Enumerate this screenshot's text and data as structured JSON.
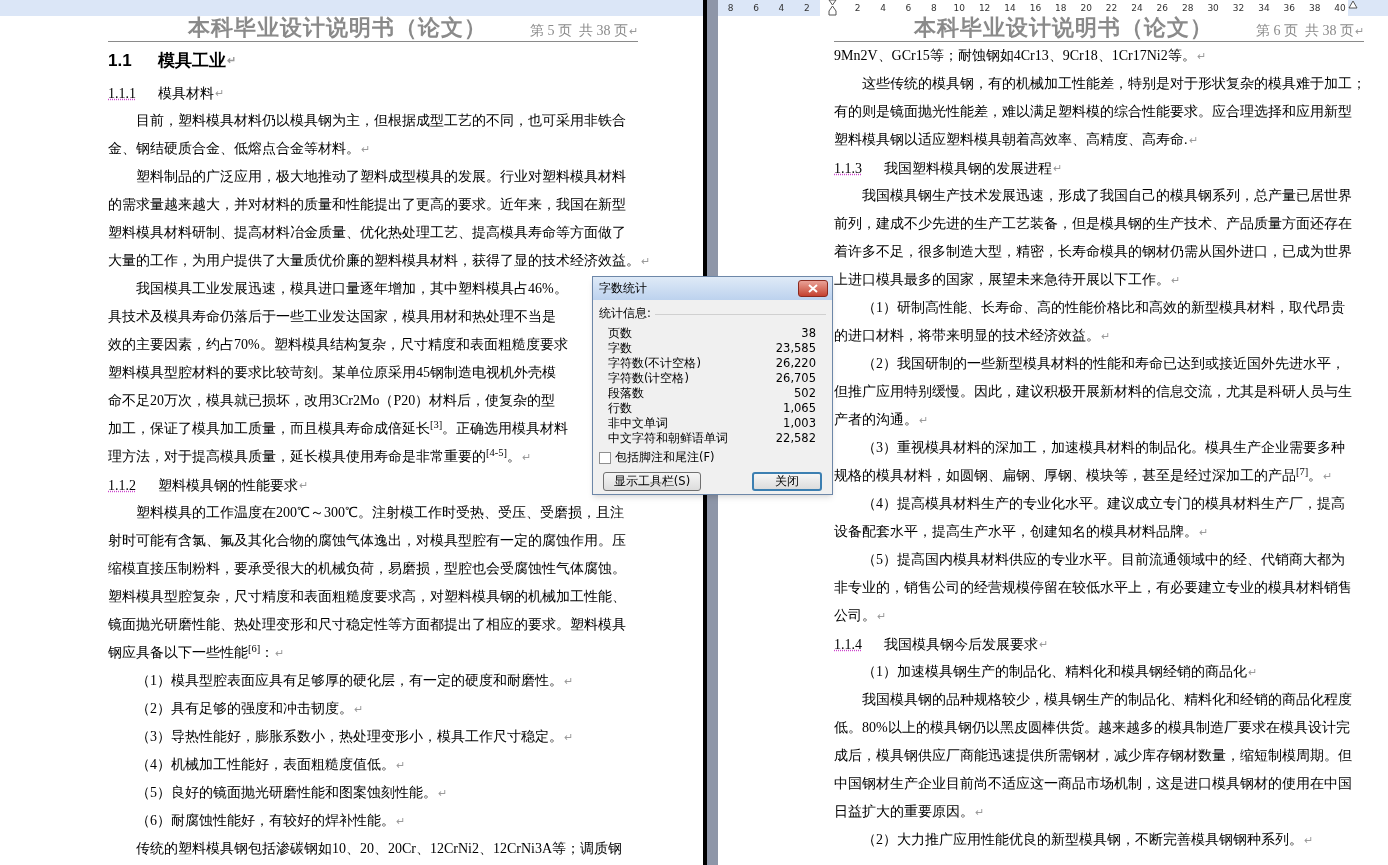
{
  "ruler": {
    "left_labels": [
      "8",
      "6",
      "4",
      "2"
    ],
    "right_labels": [
      "2",
      "4",
      "6",
      "8",
      "10",
      "12",
      "14",
      "16",
      "18",
      "20",
      "22",
      "24",
      "26",
      "28",
      "30",
      "32",
      "34",
      "36",
      "38",
      "40"
    ]
  },
  "pages": [
    {
      "header": {
        "title": "本科毕业设计说明书（论文）",
        "page_info": "第 5 页  共 38 页",
        "mark": "↵"
      },
      "blocks": [
        {
          "kind": "h2",
          "number": "1.1",
          "title": "模具工业",
          "mark": "↵"
        },
        {
          "kind": "h3",
          "number": "1.1.1",
          "title": "模具材料",
          "mark": "↵"
        },
        {
          "kind": "body",
          "lines": [
            "目前，塑料模具材料仍以模具钢为主，但根据成型工艺的不同，也可采用非铁合",
            "金、钢结硬质合金、低熔点合金等材料。"
          ],
          "mark": "↵"
        },
        {
          "kind": "body",
          "lines": [
            "塑料制品的广泛应用，极大地推动了塑料成型模具的发展。行业对塑料模具材料",
            "的需求量越来越大，并对材料的质量和性能提出了更高的要求。近年来，我国在新型",
            "塑料模具材料研制、提高材料冶金质量、优化热处理工艺、提高模具寿命等方面做了",
            "大量的工作，为用户提供了大量质优价廉的塑料模具材料，获得了显的技术经济效益。"
          ],
          "mark": "↵"
        },
        {
          "kind": "body",
          "lines": [
            "我国模具工业发展迅速，模具进口量逐年增加，其中塑料模具占46%。",
            "具技术及模具寿命仍落后于一些工业发达国家，模具用材和热处理不当是",
            "效的主要因素，约占70%。塑料模具结构复杂，尺寸精度和表面粗糙度要求",
            "塑料模具型腔材料的要求比较苛刻。某单位原采用45钢制造电视机外壳模",
            "命不足20万次，模具就已损坏，改用3Cr2Mo（P20）材料后，使复杂的型",
            "加工，保证了模具加工质量，而且模具寿命成倍延长$^{[3]}$。正确选用模具材料",
            "理方法，对于提高模具质量，延长模具使用寿命是非常重要的$^{[4-5]}$。"
          ],
          "mark": "↵"
        },
        {
          "kind": "h3",
          "number": "1.1.2",
          "title": "塑料模具钢的性能要求",
          "mark": "↵"
        },
        {
          "kind": "body",
          "lines": [
            "塑料模具的工作温度在200℃～300℃。注射模工作时受热、受压、受磨损，且注",
            "射时可能有含氯、氟及其化合物的腐蚀气体逸出，对模具型腔有一定的腐蚀作用。压",
            "缩模直接压制粉料，要承受很大的机械负荷，易磨损，型腔也会受腐蚀性气体腐蚀。",
            "塑料模具型腔复杂，尺寸精度和表面粗糙度要求高，对塑料模具钢的机械加工性能、",
            "镜面抛光研磨性能、热处理变形和尺寸稳定性等方面都提出了相应的要求。塑料模具",
            "钢应具备以下一些性能$^{[6]}$："
          ],
          "mark": "↵"
        },
        {
          "kind": "body",
          "lines": [
            "（1）模具型腔表面应具有足够厚的硬化层，有一定的硬度和耐磨性。"
          ],
          "mark": "↵"
        },
        {
          "kind": "body",
          "lines": [
            "（2）具有足够的强度和冲击韧度。"
          ],
          "mark": "↵"
        },
        {
          "kind": "body",
          "lines": [
            "（3）导热性能好，膨胀系数小，热处理变形小，模具工作尺寸稳定。"
          ],
          "mark": "↵"
        },
        {
          "kind": "body",
          "lines": [
            "（4）机械加工性能好，表面粗糙度值低。"
          ],
          "mark": "↵"
        },
        {
          "kind": "body",
          "lines": [
            "（5）良好的镜面抛光研磨性能和图案蚀刻性能。"
          ],
          "mark": "↵"
        },
        {
          "kind": "body",
          "lines": [
            "（6）耐腐蚀性能好，有较好的焊补性能。"
          ],
          "mark": "↵"
        },
        {
          "kind": "body",
          "lines": [
            "传统的塑料模具钢包括渗碳钢如10、20、20Cr、12CrNi2、12CrNi3A等；调质钢"
          ]
        }
      ]
    },
    {
      "header": {
        "title": "本科毕业设计说明书（论文）",
        "page_info": "第 6 页  共 38 页",
        "mark": "↵"
      },
      "blocks": [
        {
          "kind": "cont",
          "lines": [
            "9Mn2V、GCr15等；耐蚀钢如4Cr13、9Cr18、1Cr17Ni2等。"
          ],
          "mark": "↵"
        },
        {
          "kind": "body",
          "lines": [
            "这些传统的模具钢，有的机械加工性能差，特别是对于形状复杂的模具难于加工；",
            "有的则是镜面抛光性能差，难以满足塑料模的综合性能要求。应合理选择和应用新型",
            "塑料模具钢以适应塑料模具朝着高效率、高精度、高寿命."
          ],
          "mark": "↵"
        },
        {
          "kind": "h3",
          "number": "1.1.3",
          "title": "我国塑料模具钢的发展进程",
          "mark": "↵"
        },
        {
          "kind": "body",
          "lines": [
            "我国模具钢生产技术发展迅速，形成了我国自己的模具钢系列，总产量已居世界",
            "前列，建成不少先进的生产工艺装备，但是模具钢的生产技术、产品质量方面还存在",
            "着许多不足，很多制造大型，精密，长寿命模具的钢材仍需从国外进口，已成为世界",
            "上进口模具最多的国家，展望未来急待开展以下工作。"
          ],
          "mark": "↵"
        },
        {
          "kind": "body",
          "lines": [
            "（1）研制高性能、长寿命、高的性能价格比和高效的新型模具材料，取代昂贵",
            "的进口材料，将带来明显的技术经济效益。"
          ],
          "mark": "↵"
        },
        {
          "kind": "body",
          "lines": [
            "（2）我国研制的一些新型模具材料的性能和寿命已达到或接近国外先进水平，",
            "但推广应用特别缓慢。因此，建议积极开展新材料的信息交流，尤其是科研人员与生",
            "产者的沟通。"
          ],
          "mark": "↵"
        },
        {
          "kind": "body",
          "lines": [
            "（3）重视模具材料的深加工，加速模具材料的制品化。模具生产企业需要多种",
            "规格的模具材料，如圆钢、扁钢、厚钢、模块等，甚至是经过深加工的产品$^{[7]}$。"
          ],
          "mark": "↵"
        },
        {
          "kind": "body",
          "lines": [
            "（4）提高模具材料生产的专业化水平。建议成立专门的模具材料生产厂，提高",
            "设备配套水平，提高生产水平，创建知名的模具材料品牌。"
          ],
          "mark": "↵"
        },
        {
          "kind": "body",
          "lines": [
            "（5）提高国内模具材料供应的专业水平。目前流通领域中的经、代销商大都为",
            "非专业的，销售公司的经营规模停留在较低水平上，有必要建立专业的模具材料销售",
            "公司。"
          ],
          "mark": "↵"
        },
        {
          "kind": "h3",
          "number": "1.1.4",
          "title": "我国模具钢今后发展要求",
          "mark": "↵"
        },
        {
          "kind": "body",
          "lines": [
            "（1）加速模具钢生产的制品化、精料化和模具钢经销的商品化"
          ],
          "mark": "↵"
        },
        {
          "kind": "body",
          "lines": [
            "我国模具钢的品种规格较少，模具钢生产的制品化、精料化和经销的商品化程度",
            "低。80%以上的模具钢仍以黑皮圆棒供货。越来越多的模具制造厂要求在模具设计完",
            "成后，模具钢供应厂商能迅速提供所需钢材，减少库存钢材数量，缩短制模周期。但",
            "中国钢材生产企业目前尚不适应这一商品市场机制，这是进口模具钢材的使用在中国",
            "日益扩大的重要原因。"
          ],
          "mark": "↵"
        },
        {
          "kind": "body",
          "lines": [
            "（2）大力推广应用性能优良的新型模具钢，不断完善模具钢钢种系列。"
          ],
          "mark": "↵"
        }
      ]
    }
  ],
  "dialog": {
    "title": "字数统计",
    "section": "统计信息:",
    "stats": [
      {
        "label": "页数",
        "value": "38"
      },
      {
        "label": "字数",
        "value": "23,585"
      },
      {
        "label": "字符数(不计空格)",
        "value": "26,220"
      },
      {
        "label": "字符数(计空格)",
        "value": "26,705"
      },
      {
        "label": "段落数",
        "value": "502"
      },
      {
        "label": "行数",
        "value": "1,065"
      },
      {
        "label": "非中文单词",
        "value": "1,003"
      },
      {
        "label": "中文字符和朝鲜语单词",
        "value": "22,582"
      }
    ],
    "checkbox": {
      "label": "包括脚注和尾注(F)",
      "checked": false
    },
    "buttons": [
      {
        "label": "显示工具栏(S)",
        "default": false
      },
      {
        "label": "关闭",
        "default": true
      }
    ]
  }
}
